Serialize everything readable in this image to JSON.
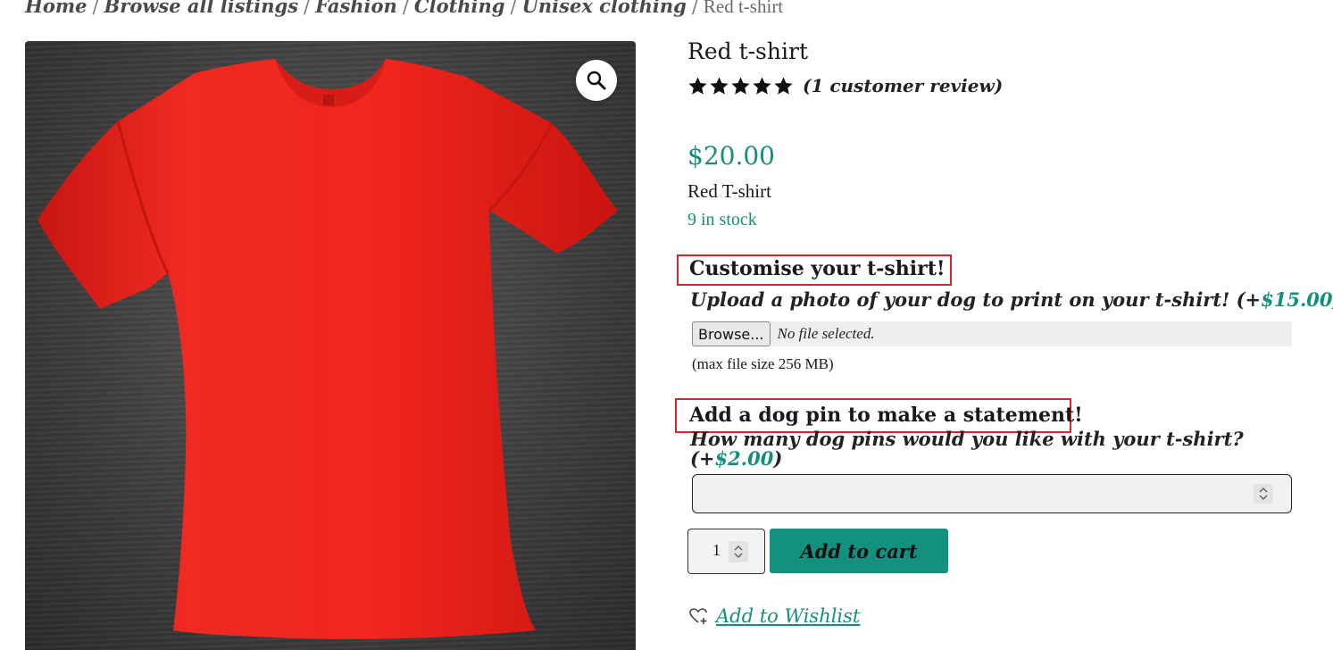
{
  "breadcrumb": {
    "items": [
      "Home",
      "Browse all listings",
      "Fashion",
      "Clothing",
      "Unisex clothing"
    ],
    "current": "Red t-shirt",
    "separator": "/"
  },
  "gallery": {
    "image_alt": "Red t-shirt",
    "zoom_icon": "magnifier-icon"
  },
  "product": {
    "title": "Red t-shirt",
    "rating": 5,
    "rating_max": 5,
    "review_text": "(1 customer review)",
    "price": "$20.00",
    "short_description": "Red T-shirt",
    "stock": "9 in stock"
  },
  "addons": [
    {
      "heading": "Customise your t-shirt!",
      "description_prefix": "Upload a photo of your dog to print on your t-shirt! (+",
      "price": "$15.00",
      "description_suffix": ")",
      "browse_label": "Browse...",
      "file_status": "No file selected.",
      "max_size": "(max file size 256 MB)"
    },
    {
      "heading": "Add a dog pin to make a statement!",
      "description_prefix": "How many dog pins would you like with your t-shirt? (+",
      "price": "$2.00",
      "description_suffix": ")",
      "value": ""
    }
  ],
  "cart": {
    "quantity": "1",
    "add_label": "Add to cart"
  },
  "wishlist": {
    "label": "Add to Wishlist",
    "icon": "heart-plus-icon"
  },
  "colors": {
    "accent": "#13907d",
    "button": "#14917e",
    "highlight": "#d6262e",
    "shirt": "#e8221e"
  }
}
